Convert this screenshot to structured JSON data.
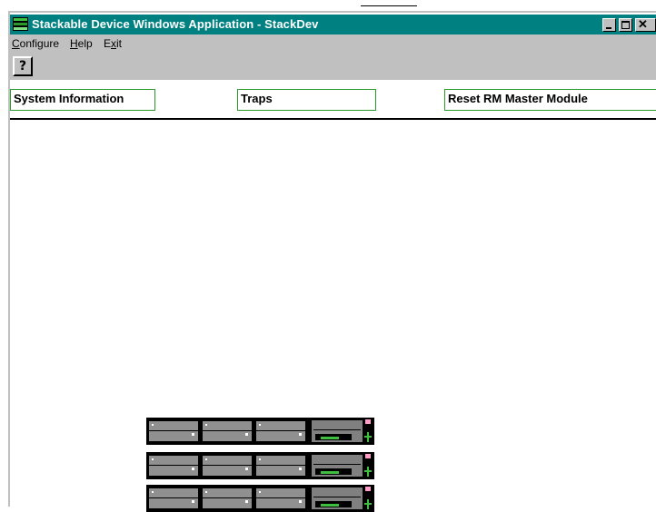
{
  "window": {
    "title": "Stackable Device Windows Application - StackDev",
    "controls": {
      "minimize": "minimize",
      "maximize": "maximize",
      "close": "✕"
    }
  },
  "menu": {
    "items": [
      {
        "label": "Configure",
        "mnemonic": "C"
      },
      {
        "label": "Help",
        "mnemonic": "H"
      },
      {
        "label": "Exit",
        "mnemonic": "x"
      }
    ]
  },
  "toolbar": {
    "help_glyph": "?"
  },
  "tabs": [
    {
      "label": "System Information"
    },
    {
      "label": "Traps"
    },
    {
      "label": "Reset RM Master Module"
    }
  ],
  "device_stack": {
    "units": [
      {
        "name": "stack-unit-1"
      },
      {
        "name": "stack-unit-2"
      },
      {
        "name": "stack-unit-3"
      }
    ]
  },
  "colors": {
    "titlebar": "#008080",
    "chrome": "#c0c0c0",
    "tab_border": "#2a9a2a",
    "led_green": "#3fbf3f",
    "led_pink": "#ff9ec8"
  }
}
